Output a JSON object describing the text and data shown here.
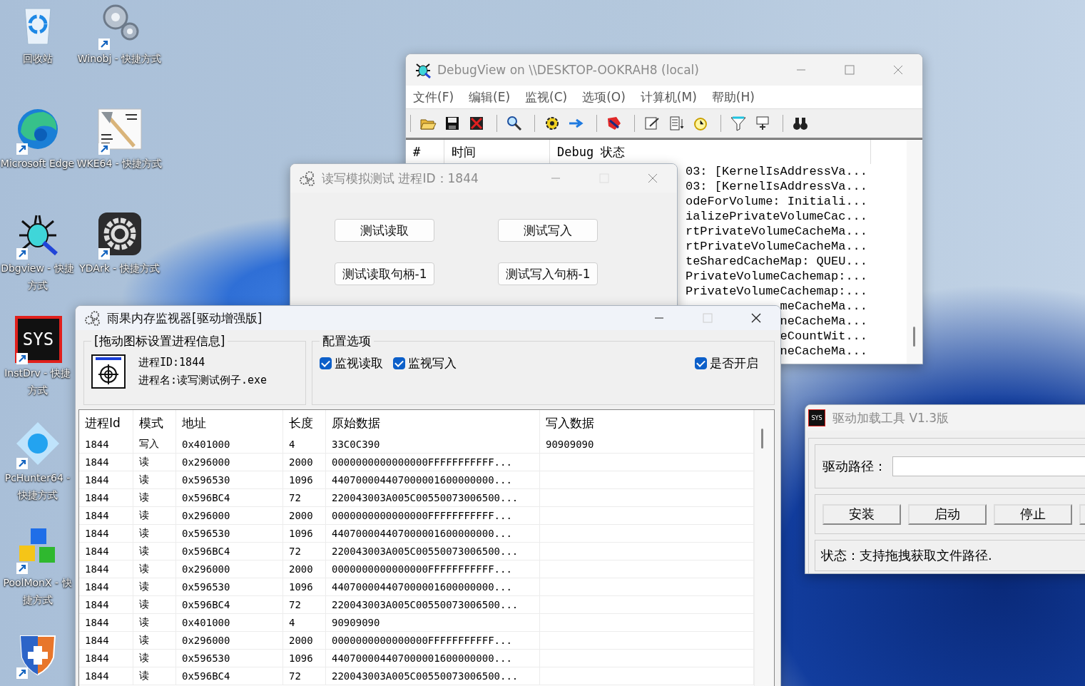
{
  "desktop_icons": [
    {
      "kind": "recycle",
      "label": "回收站",
      "shortcut": false
    },
    {
      "kind": "edge",
      "label": "Microsoft Edge",
      "shortcut": true
    },
    {
      "kind": "dbgview",
      "label": "Dbgview - 快捷方式",
      "shortcut": true
    },
    {
      "kind": "instdrv",
      "label": "InstDrv - 快捷方式",
      "logo_text": "SYS",
      "shortcut": true
    },
    {
      "kind": "pchunter",
      "label": "PcHunter64 - 快捷方式",
      "shortcut": true
    },
    {
      "kind": "poolmon",
      "label": "PoolMonX - 快捷方式",
      "shortcut": true
    },
    {
      "kind": "shield",
      "shortcut": true
    },
    {
      "kind": "winobj",
      "label": "Winobj - 快捷方式",
      "shortcut": true
    },
    {
      "kind": "wke",
      "label": "WKE64 - 快捷方式",
      "shortcut": true
    },
    {
      "kind": "ydark",
      "label": "YDArk - 快捷方式",
      "shortcut": true
    }
  ],
  "debugview": {
    "title": "DebugView on \\\\DESKTOP-OOKRAH8 (local)",
    "active": false,
    "menu": [
      "文件(F)",
      "编辑(E)",
      "监视(C)",
      "选项(O)",
      "计算机(M)",
      "帮助(H)"
    ],
    "toolbar_groups": [
      {
        "tools": [
          {
            "kind": "open"
          },
          {
            "kind": "save"
          },
          {
            "kind": "clear"
          }
        ]
      },
      {
        "tools": [
          {
            "kind": "find"
          }
        ]
      },
      {
        "tools": [
          {
            "kind": "capture"
          },
          {
            "kind": "scroll"
          }
        ]
      },
      {
        "tools": [
          {
            "kind": "kernel"
          }
        ]
      },
      {
        "tools": [
          {
            "kind": "edit"
          },
          {
            "kind": "list"
          },
          {
            "kind": "clock"
          }
        ]
      },
      {
        "tools": [
          {
            "kind": "filter"
          },
          {
            "kind": "highlight"
          }
        ]
      },
      {
        "tools": [
          {
            "kind": "binoculars"
          }
        ]
      }
    ],
    "columns": [
      "#",
      "时间",
      "Debug 状态"
    ],
    "lines": [
      "03: [KernelIsAddressVa...",
      "03: [KernelIsAddressVa...",
      "odeForVolume: Initiali...",
      "ializePrivateVolumeCac...",
      "rtPrivateVolumeCacheMa...",
      "rtPrivateVolumeCacheMa...",
      "teSharedCacheMap: QUEU...",
      "PrivateVolumeCachemap:...",
      "PrivateVolumeCachemap:...",
      "meCacheMa...",
      "neCacheMa...",
      "eCountWit...",
      "neCacheMa..."
    ]
  },
  "test_window": {
    "title": "读写模拟测试  进程ID：1844",
    "active": false,
    "buttons": [
      "测试读取",
      "测试写入",
      "测试读取句柄-1",
      "测试写入句柄-1"
    ]
  },
  "monitor": {
    "title": "雨果内存监视器[驱动增强版]",
    "active": true,
    "process_group": {
      "title": "[拖动图标设置进程信息]",
      "pid": "进程ID:1844",
      "name": "进程名:读写测试例子.exe"
    },
    "options": {
      "title": "配置选项",
      "checkboxes": [
        {
          "label": "监视读取",
          "checked": true
        },
        {
          "label": "监视写入",
          "checked": true
        },
        {
          "label": "是否开启",
          "checked": true
        }
      ]
    },
    "table": {
      "columns": [
        "进程Id",
        "模式",
        "地址",
        "长度",
        "原始数据",
        "写入数据"
      ],
      "rows": [
        [
          "1844",
          "写入",
          "0x401000",
          "4",
          "33C0C390",
          "90909090"
        ],
        [
          "1844",
          "读",
          "0x296000",
          "2000",
          "0000000000000000FFFFFFFFFFF..."
        ],
        [
          "1844",
          "读",
          "0x596530",
          "1096",
          "440700004407000001600000000..."
        ],
        [
          "1844",
          "读",
          "0x596BC4",
          "72",
          "220043003A005C00550073006500..."
        ],
        [
          "1844",
          "读",
          "0x296000",
          "2000",
          "0000000000000000FFFFFFFFFFF..."
        ],
        [
          "1844",
          "读",
          "0x596530",
          "1096",
          "440700004407000001600000000..."
        ],
        [
          "1844",
          "读",
          "0x596BC4",
          "72",
          "220043003A005C00550073006500..."
        ],
        [
          "1844",
          "读",
          "0x296000",
          "2000",
          "0000000000000000FFFFFFFFFFF..."
        ],
        [
          "1844",
          "读",
          "0x596530",
          "1096",
          "440700004407000001600000000..."
        ],
        [
          "1844",
          "读",
          "0x596BC4",
          "72",
          "220043003A005C00550073006500..."
        ],
        [
          "1844",
          "读",
          "0x401000",
          "4",
          "90909090"
        ],
        [
          "1844",
          "读",
          "0x296000",
          "2000",
          "0000000000000000FFFFFFFFFFF..."
        ],
        [
          "1844",
          "读",
          "0x596530",
          "1096",
          "440700004407000001600000000..."
        ],
        [
          "1844",
          "读",
          "0x596BC4",
          "72",
          "220043003A005C00550073006500..."
        ]
      ]
    }
  },
  "driver_tool": {
    "title": "驱动加载工具 V1.3版",
    "active": false,
    "icon_text": "SYS",
    "path_label": "驱动路径：",
    "buttons": [
      "安装",
      "启动",
      "停止"
    ],
    "status": "状态：支持拖拽获取文件路径."
  }
}
